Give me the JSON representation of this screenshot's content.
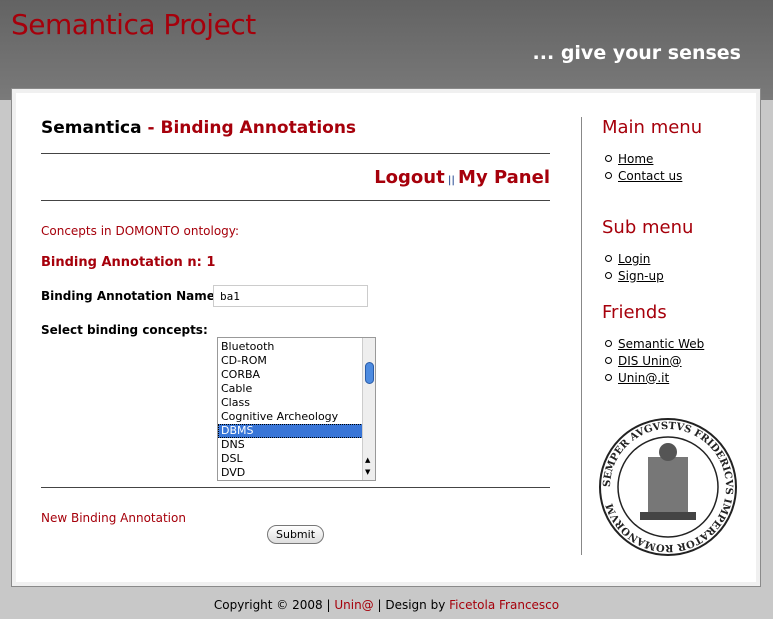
{
  "header": {
    "title": "Semantica Project",
    "tagline": "... give your senses"
  },
  "main": {
    "heading_prefix": "Semantica",
    "heading_sep": " - ",
    "heading_title": "Binding Annotations",
    "nav": {
      "logout": "Logout",
      "separator": "||",
      "my_panel": "My Panel"
    },
    "concepts_label": "Concepts in DOMONTO ontology:",
    "binding_heading": "Binding Annotation n: 1",
    "name_label": "Binding Annotation Name:",
    "name_value": "ba1",
    "concepts_select_label": "Select binding concepts:",
    "concepts": [
      "Bluetooth",
      "CD-ROM",
      "CORBA",
      "Cable",
      "Class",
      "Cognitive Archeology",
      "DBMS",
      "DNS",
      "DSL",
      "DVD"
    ],
    "selected_concept": "DBMS",
    "new_binding_link": "New Binding Annotation",
    "submit_label": "Submit"
  },
  "sidebar": {
    "main_menu": {
      "title": "Main menu",
      "items": [
        "Home",
        "Contact us"
      ]
    },
    "sub_menu": {
      "title": "Sub menu",
      "items": [
        "Login",
        "Sign-up"
      ]
    },
    "friends": {
      "title": "Friends",
      "items": [
        "Semantic Web",
        "DIS Unin@",
        "Unin@.it"
      ]
    },
    "seal_text": "SEMPER AVGVSTVS FRIDERICVS IMPERATOR ROMANORVM"
  },
  "footer": {
    "copyright": "Copyright © 2008 | ",
    "unina": "Unin@",
    "design_by": " | Design by ",
    "author": "Ficetola Francesco"
  },
  "colors": {
    "accent": "#a6000b",
    "selection": "#3875d7"
  }
}
